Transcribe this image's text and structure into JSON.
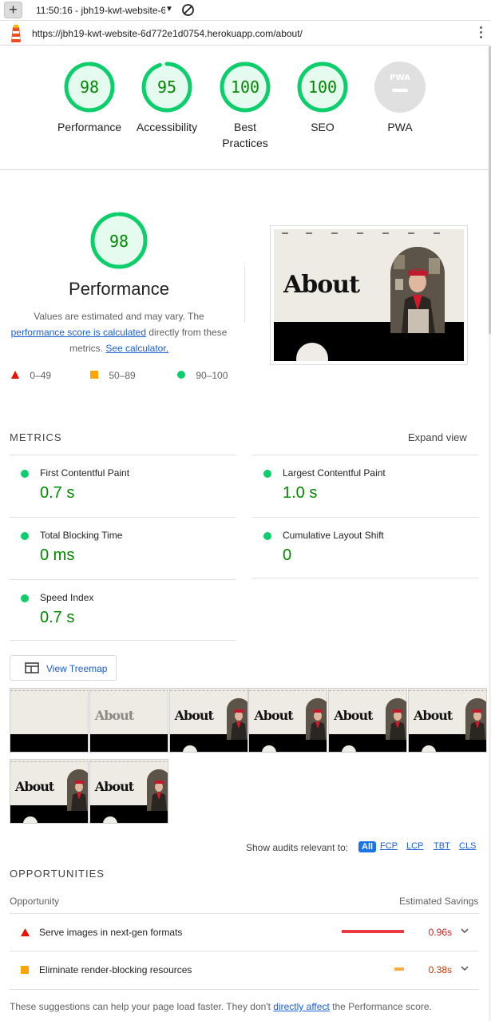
{
  "browser": {
    "tab_title": "11:50:16 - jbh19-kwt-website-6",
    "url": "https://jbh19-kwt-website-6d772e1d0754.herokuapp.com/about/"
  },
  "colors": {
    "pass": "#0cce6b",
    "pass_text": "#008800",
    "average": "#ffa400",
    "fail": "#eb0f00",
    "link": "#1a5fd5"
  },
  "gauges": [
    {
      "score": "98",
      "label": "Performance",
      "fraction": 0.98
    },
    {
      "score": "95",
      "label": "Accessibility",
      "fraction": 0.95
    },
    {
      "score": "100",
      "label": "Best Practices",
      "fraction": 1.0
    },
    {
      "score": "100",
      "label": "SEO",
      "fraction": 1.0
    },
    {
      "score": "",
      "label": "PWA",
      "badge": "PWA"
    }
  ],
  "performance": {
    "score": "98",
    "fraction": 0.98,
    "title": "Performance",
    "desc_1": "Values are estimated and may vary. The ",
    "desc_link": "performance score is calculated",
    "desc_2": " directly from these metrics. ",
    "calc_link": "See calculator.",
    "legend": {
      "fail": "0–49",
      "average": "50–89",
      "pass": "90–100"
    }
  },
  "screenshot": {
    "heading": "About"
  },
  "metrics": {
    "title": "METRICS",
    "expand_label": "Expand view",
    "items": [
      {
        "name": "First Contentful Paint",
        "value": "0.7 s"
      },
      {
        "name": "Largest Contentful Paint",
        "value": "1.0 s"
      },
      {
        "name": "Total Blocking Time",
        "value": "0 ms"
      },
      {
        "name": "Cumulative Layout Shift",
        "value": "0"
      },
      {
        "name": "Speed Index",
        "value": "0.7 s"
      }
    ]
  },
  "treemap": {
    "label": "View Treemap"
  },
  "filmstrip": {
    "frame_heading": "About",
    "frame_count": 8
  },
  "audit_filter": {
    "label": "Show audits relevant to:",
    "options": [
      "All",
      "FCP",
      "LCP",
      "TBT",
      "CLS"
    ],
    "selected": "All"
  },
  "opportunities": {
    "title": "OPPORTUNITIES",
    "col_opportunity": "Opportunity",
    "col_savings": "Estimated Savings",
    "items": [
      {
        "title": "Serve images in next-gen formats",
        "savings": "0.96s",
        "severity": "fail",
        "savings_fraction": 0.96
      },
      {
        "title": "Eliminate render-blocking resources",
        "savings": "0.38s",
        "severity": "average",
        "savings_fraction": 0.38
      }
    ],
    "footnote_1": "These suggestions can help your page load faster. They don't ",
    "footnote_link": "directly affect",
    "footnote_2": " the Performance score."
  }
}
